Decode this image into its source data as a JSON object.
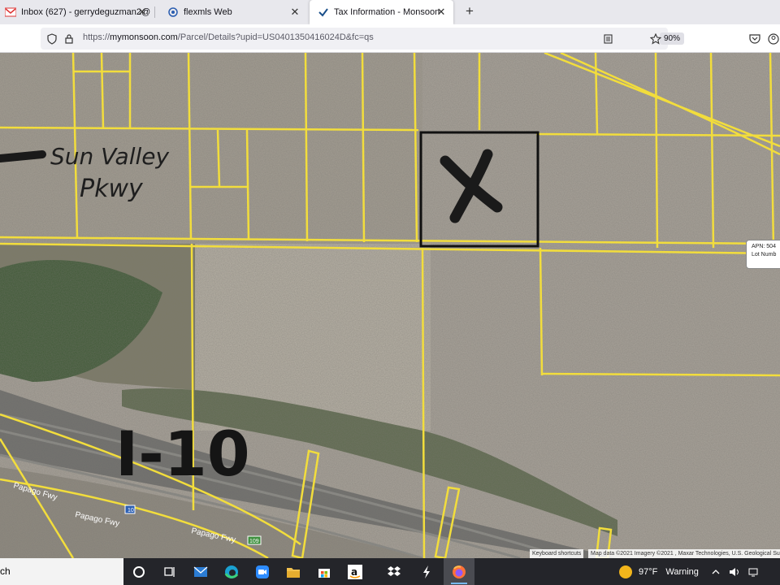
{
  "tabs": [
    {
      "title": "Inbox (627) - gerrydeguzman2@",
      "icon": "gmail-icon",
      "badge": "99+"
    },
    {
      "title": "flexmls Web",
      "icon": "flexmls-icon"
    },
    {
      "title": "Tax Information - Monsoon",
      "icon": "monsoon-icon",
      "active": true
    }
  ],
  "new_tab_symbol": "+",
  "url": {
    "scheme": "https://",
    "domain": "mymonsoon.com",
    "path": "/Parcel/Details?upid=US0401350416024D&fc=qs"
  },
  "zoom_level": "90%",
  "map": {
    "annotations": [
      "Sun Valley",
      "Pkwy",
      "I-10"
    ],
    "road_labels": [
      "Papago Fwy",
      "Papago Fwy",
      "Papago Fwy"
    ],
    "highway_shields": [
      "10",
      "109"
    ],
    "tooltip_lines": [
      "APN: 504",
      "Lot Numb"
    ],
    "attribution_shortcuts": "Keyboard shortcuts",
    "attribution_data": "Map data ©2021 Imagery ©2021 , Maxar Technologies, U.S. Geological Su",
    "colors": {
      "parcel_line": "#f2dd3c",
      "selected_parcel": "#111111",
      "marker": "#1a1a1a"
    }
  },
  "taskbar": {
    "search_text": "ch",
    "weather_temp": "97°F",
    "weather_status": "Warning"
  }
}
